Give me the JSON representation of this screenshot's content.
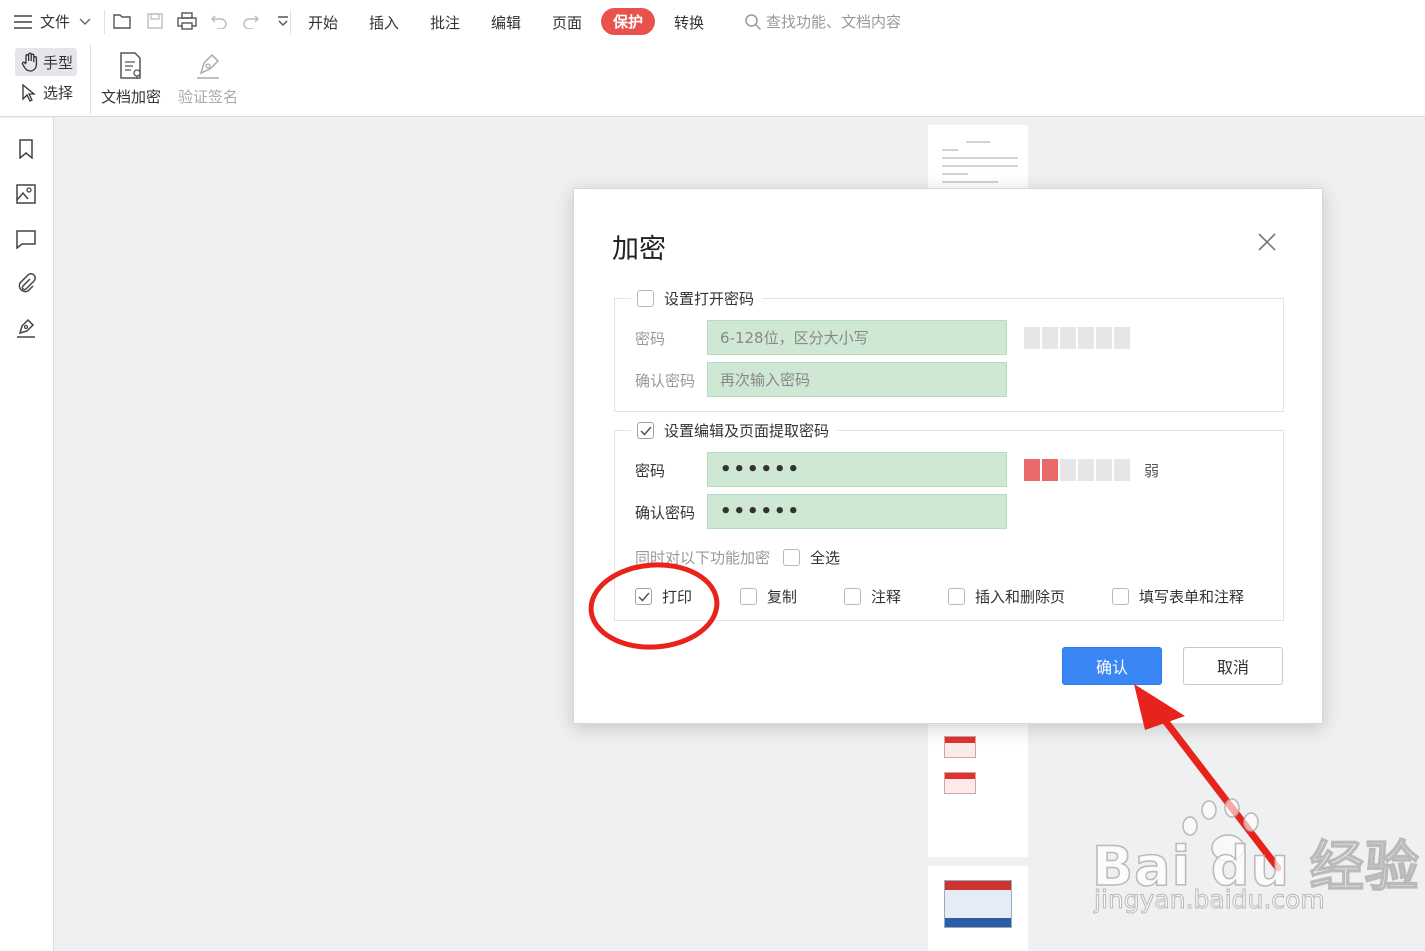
{
  "menubar": {
    "file_label": "文件",
    "tabs": [
      "开始",
      "插入",
      "批注",
      "编辑",
      "页面",
      "保护",
      "转换"
    ],
    "active_tab": "保护",
    "search_placeholder": "查找功能、文档内容"
  },
  "ribbon": {
    "hand_label": "手型",
    "select_label": "选择",
    "encrypt_label": "文档加密",
    "verify_label": "验证签名"
  },
  "dialog": {
    "title": "加密",
    "open_password": {
      "checkbox_label": "设置打开密码",
      "checked": false,
      "password_label": "密码",
      "password_placeholder": "6-128位，区分大小写",
      "confirm_label": "确认密码",
      "confirm_placeholder": "再次输入密码",
      "strength_filled": 0
    },
    "edit_password": {
      "checkbox_label": "设置编辑及页面提取密码",
      "checked": true,
      "password_label": "密码",
      "password_value": "••••••",
      "confirm_label": "确认密码",
      "confirm_value": "••••••",
      "strength_filled": 2,
      "strength_label": "弱",
      "also_encrypt_label": "同时对以下功能加密",
      "select_all_label": "全选",
      "options": [
        {
          "label": "打印",
          "checked": true
        },
        {
          "label": "复制",
          "checked": false
        },
        {
          "label": "注释",
          "checked": false
        },
        {
          "label": "插入和删除页",
          "checked": false
        },
        {
          "label": "填写表单和注释",
          "checked": false
        }
      ]
    },
    "ok_label": "确认",
    "cancel_label": "取消"
  },
  "watermark": {
    "line1": "Bai du 经验",
    "line2": "jingyan.baidu.com"
  },
  "colors": {
    "active_tab": "#e8514c",
    "primary_button": "#3a86f4",
    "password_field": "#cfe8d4",
    "strength_red": "#e9686a",
    "annotation_red": "#e8231c"
  }
}
